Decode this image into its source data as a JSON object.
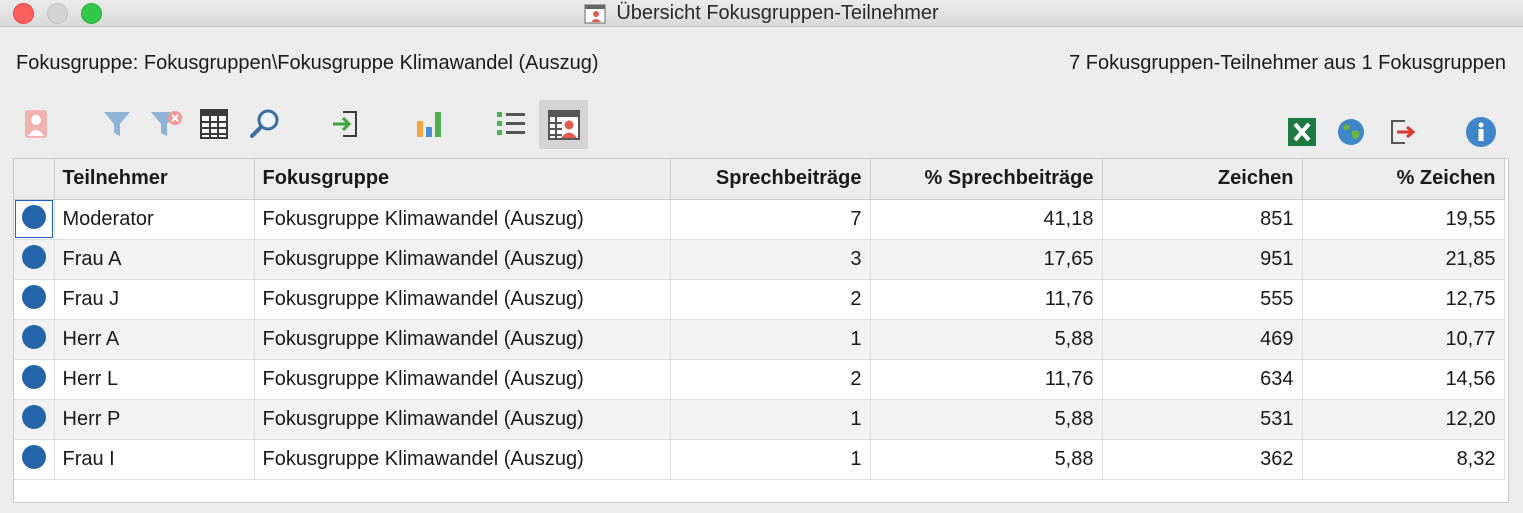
{
  "window": {
    "title": "Übersicht Fokusgruppen-Teilnehmer"
  },
  "info": {
    "focus_group": "Fokusgruppe: Fokusgruppen\\Fokusgruppe Klimawandel (Auszug)",
    "summary": "7 Fokusgruppen-Teilnehmer aus 1 Fokusgruppen"
  },
  "toolbar": {
    "left": [
      "participant-icon",
      "filter-icon",
      "filter-remove-icon",
      "columns-icon",
      "search-icon",
      "import-icon",
      "bar-chart-icon",
      "list-icon",
      "participant-overview-icon"
    ],
    "right": [
      "excel-export-icon",
      "web-export-icon",
      "exit-icon",
      "info-icon"
    ]
  },
  "table": {
    "headers": [
      "",
      "Teilnehmer",
      "Fokusgruppe",
      "Sprechbeiträge",
      "% Sprechbeiträge",
      "Zeichen",
      "% Zeichen"
    ],
    "rows": [
      [
        "Moderator",
        "Fokusgruppe Klimawandel (Auszug)",
        "7",
        "41,18",
        "851",
        "19,55"
      ],
      [
        "Frau A",
        "Fokusgruppe Klimawandel (Auszug)",
        "3",
        "17,65",
        "951",
        "21,85"
      ],
      [
        "Frau J",
        "Fokusgruppe Klimawandel (Auszug)",
        "2",
        "11,76",
        "555",
        "12,75"
      ],
      [
        "Herr A",
        "Fokusgruppe Klimawandel (Auszug)",
        "1",
        "5,88",
        "469",
        "10,77"
      ],
      [
        "Herr L",
        "Fokusgruppe Klimawandel (Auszug)",
        "2",
        "11,76",
        "634",
        "14,56"
      ],
      [
        "Herr P",
        "Fokusgruppe Klimawandel (Auszug)",
        "1",
        "5,88",
        "531",
        "12,20"
      ],
      [
        "Frau I",
        "Fokusgruppe Klimawandel (Auszug)",
        "1",
        "5,88",
        "362",
        "8,32"
      ]
    ]
  },
  "colors": {
    "dot": "#2566ab",
    "accent": "#e05a4e"
  }
}
